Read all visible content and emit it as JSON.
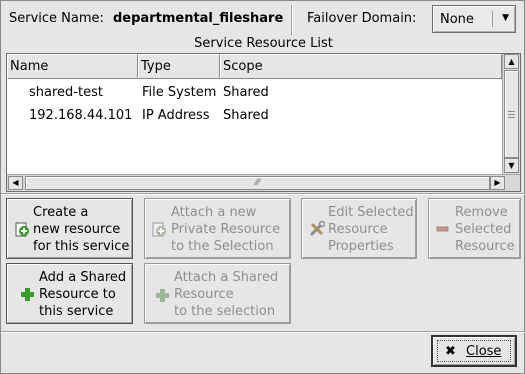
{
  "header": {
    "service_name_label": "Service Name:",
    "service_name_value": "departmental_fileshare",
    "failover_domain_label": "Failover Domain:",
    "failover_domain_value": "None"
  },
  "list": {
    "title": "Service Resource List",
    "columns": [
      "Name",
      "Type",
      "Scope"
    ],
    "rows": [
      [
        "shared-test",
        "File System",
        "Shared"
      ],
      [
        "192.168.44.101",
        "IP Address",
        "Shared"
      ]
    ]
  },
  "actions": {
    "create_new": "Create a\nnew resource\nfor this service",
    "attach_private": "Attach a new\nPrivate Resource\nto the Selection",
    "edit_selected": "Edit Selected\nResource\nProperties",
    "remove_selected": "Remove\nSelected\nResource",
    "add_shared": "Add a Shared\nResource to\nthis service",
    "attach_shared": "Attach a Shared\nResource\nto the selection"
  },
  "footer": {
    "close_label": "Close"
  },
  "colors": {
    "background": "#e6e6e6",
    "disabled_text": "#8f8f8f",
    "icon_green": "#3a9a2a"
  }
}
